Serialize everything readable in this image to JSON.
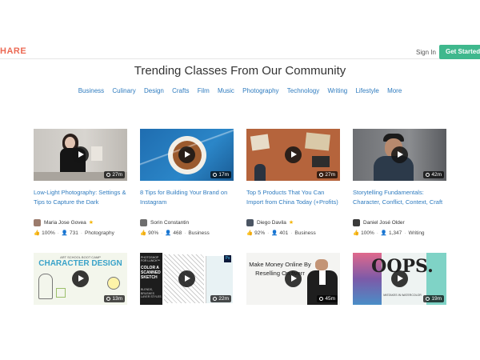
{
  "header": {
    "logo": "HARE",
    "sign_in": "Sign In",
    "get_started": "Get Started"
  },
  "heading": "Trending Classes From Our Community",
  "categories": [
    "Business",
    "Culinary",
    "Design",
    "Crafts",
    "Film",
    "Music",
    "Photography",
    "Technology",
    "Writing",
    "Lifestyle",
    "More"
  ],
  "classes": [
    {
      "title": "Low-Light Photography: Settings & Tips to Capture the Dark",
      "author": "Maria Jose Govea",
      "starred": true,
      "rating": "100%",
      "students": "731",
      "category": "Photography",
      "duration": "27m"
    },
    {
      "title": "8 Tips for Building Your Brand on Instagram",
      "author": "Sorin Constantin",
      "starred": false,
      "rating": "90%",
      "students": "468",
      "category": "Business",
      "duration": "17m"
    },
    {
      "title": "Top 5 Products That You Can Import from China Today (+Profits)",
      "author": "Diego Davila",
      "starred": true,
      "rating": "92%",
      "students": "401",
      "category": "Business",
      "duration": "27m"
    },
    {
      "title": "Storytelling Fundamentals: Character, Conflict, Context, Craft",
      "author": "Daniel José Older",
      "starred": false,
      "rating": "100%",
      "students": "1,347",
      "category": "Writing",
      "duration": "42m"
    }
  ],
  "row2": [
    {
      "thumb_text": "CHARACTER DESIGN",
      "thumb_subtext": "ART SCHOOL BOOT CAMP",
      "duration": "13m"
    },
    {
      "thumb_text": "COLOR A SCANNED SKETCH",
      "thumb_subtext": "PHOTOSHOP FOR LUNCH™",
      "thumb_subtext2": "BLENDS, BRUSHES LAYER STYLES",
      "duration": "22m"
    },
    {
      "thumb_text": "Make Money Online By Reselling On fiverr",
      "duration": "45m"
    },
    {
      "thumb_text": "OOPS.",
      "thumb_subtext": "MISTAKES IN WATERCOLOR",
      "duration": "19m"
    }
  ]
}
